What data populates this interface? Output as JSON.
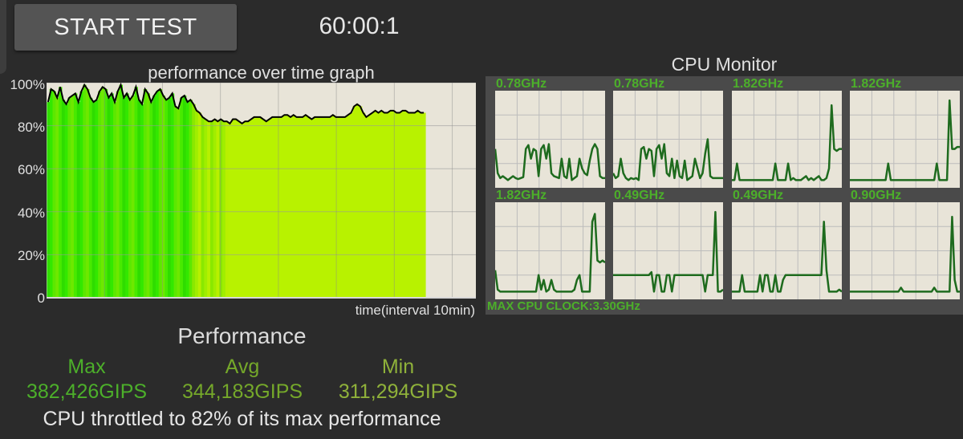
{
  "controls": {
    "start_label": "START TEST",
    "timer": "60:00:1"
  },
  "performance_graph": {
    "title": "performance over time graph",
    "y_ticks": [
      "100%",
      "80%",
      "60%",
      "40%",
      "20%",
      "0"
    ],
    "x_axis_label": "time(interval 10min)"
  },
  "chart_data": {
    "type": "area",
    "title": "performance over time graph",
    "xlabel": "time(interval 10min)",
    "ylabel": "",
    "ylim": [
      0,
      100
    ],
    "y_ticks": [
      "100%",
      "80%",
      "60%",
      "40%",
      "20%",
      "0"
    ],
    "grid": true,
    "series": [
      {
        "values": [
          91,
          97,
          96,
          93,
          98,
          92,
          90,
          93,
          94,
          95,
          91,
          96,
          99,
          97,
          93,
          91,
          92,
          96,
          98,
          97,
          93,
          95,
          91,
          96,
          99,
          93,
          95,
          92,
          94,
          98,
          92,
          90,
          97,
          95,
          91,
          94,
          96,
          97,
          94,
          92,
          93,
          95,
          89,
          88,
          93,
          94,
          91,
          92,
          90,
          87,
          86,
          84,
          83,
          82,
          82,
          83,
          82,
          83,
          82,
          82,
          81,
          83,
          83,
          82,
          81,
          82,
          82,
          83,
          84,
          84,
          84,
          83,
          82,
          83,
          84,
          84,
          84,
          84,
          85,
          85,
          84,
          85,
          84,
          84,
          84,
          85,
          84,
          83,
          84,
          84,
          84,
          84,
          84,
          84,
          85,
          84,
          84,
          84,
          84,
          85,
          86,
          89,
          90,
          89,
          86,
          84,
          85,
          86,
          87,
          86,
          87,
          86,
          86,
          87,
          87,
          86,
          86,
          87,
          87,
          86,
          86,
          86,
          87,
          86,
          86
        ]
      }
    ]
  },
  "cpu_monitor": {
    "title": "CPU Monitor",
    "cores": [
      {
        "freq": "0.78GHz",
        "values": [
          40,
          15,
          10,
          12,
          10,
          8,
          10,
          12,
          10,
          9,
          10,
          11,
          40,
          44,
          30,
          40,
          38,
          12,
          40,
          44,
          30,
          45,
          15,
          12,
          11,
          10,
          30,
          12,
          10,
          30,
          8,
          10,
          12,
          30,
          20,
          15,
          13,
          28,
          40,
          45,
          40,
          12,
          10,
          10
        ]
      },
      {
        "freq": "0.78GHz",
        "values": [
          15,
          10,
          12,
          30,
          15,
          10,
          8,
          10,
          9,
          10,
          8,
          40,
          42,
          30,
          40,
          38,
          12,
          40,
          44,
          30,
          45,
          15,
          12,
          30,
          10,
          28,
          12,
          10,
          28,
          8,
          10,
          12,
          30,
          20,
          10,
          15,
          35,
          50,
          12,
          10,
          10,
          10,
          10,
          10
        ]
      },
      {
        "freq": "1.82GHz",
        "values": [
          8,
          8,
          25,
          8,
          8,
          8,
          8,
          8,
          8,
          8,
          8,
          8,
          8,
          8,
          8,
          8,
          8,
          25,
          8,
          8,
          8,
          8,
          25,
          8,
          10,
          8,
          8,
          8,
          10,
          12,
          8,
          10,
          8,
          10,
          12,
          8,
          8,
          10,
          20,
          85,
          40,
          38,
          40,
          40
        ]
      },
      {
        "freq": "1.82GHz",
        "values": [
          8,
          8,
          8,
          8,
          8,
          8,
          8,
          8,
          8,
          8,
          8,
          8,
          8,
          8,
          8,
          25,
          8,
          8,
          8,
          8,
          8,
          8,
          8,
          8,
          8,
          8,
          8,
          8,
          8,
          8,
          8,
          8,
          8,
          8,
          25,
          8,
          8,
          8,
          8,
          90,
          40,
          40,
          42,
          42
        ]
      },
      {
        "freq": "1.82GHz",
        "values": [
          30,
          10,
          8,
          8,
          8,
          8,
          8,
          8,
          8,
          8,
          8,
          8,
          8,
          8,
          8,
          8,
          8,
          25,
          10,
          20,
          8,
          10,
          20,
          10,
          8,
          8,
          8,
          8,
          8,
          8,
          8,
          10,
          20,
          25,
          8,
          8,
          8,
          8,
          80,
          88,
          40,
          38,
          40,
          38
        ]
      },
      {
        "freq": "0.49GHz",
        "values": [
          25,
          25,
          25,
          25,
          25,
          25,
          25,
          25,
          25,
          25,
          25,
          25,
          25,
          25,
          25,
          28,
          8,
          25,
          25,
          8,
          8,
          25,
          25,
          8,
          25,
          25,
          25,
          25,
          25,
          25,
          25,
          25,
          25,
          25,
          25,
          25,
          8,
          25,
          25,
          25,
          90,
          8,
          8,
          10
        ]
      },
      {
        "freq": "0.49GHz",
        "values": [
          8,
          8,
          8,
          8,
          25,
          8,
          8,
          8,
          8,
          8,
          8,
          25,
          8,
          25,
          25,
          8,
          8,
          25,
          8,
          8,
          20,
          25,
          25,
          25,
          25,
          25,
          25,
          25,
          25,
          25,
          25,
          25,
          25,
          25,
          25,
          25,
          80,
          30,
          8,
          8,
          8,
          8,
          10,
          8
        ]
      },
      {
        "freq": "0.90GHz",
        "values": [
          8,
          8,
          8,
          8,
          8,
          8,
          8,
          8,
          8,
          8,
          8,
          8,
          8,
          8,
          8,
          8,
          8,
          8,
          8,
          8,
          12,
          8,
          8,
          8,
          8,
          8,
          8,
          8,
          8,
          8,
          8,
          8,
          8,
          12,
          8,
          8,
          8,
          8,
          8,
          8,
          85,
          20,
          8,
          8
        ]
      }
    ],
    "max_clock": "MAX CPU CLOCK:3.30GHz"
  },
  "summary": {
    "heading": "Performance",
    "max_label": "Max",
    "avg_label": "Avg",
    "min_label": "Min",
    "max_value": "382,426GIPS",
    "avg_value": "344,183GIPS",
    "min_value": "311,294GIPS",
    "throttle_text": "CPU throttled to 82% of its max performance"
  },
  "colors": {
    "background": "#2b2b2b",
    "button": "#545454",
    "plot_bg": "#e8e4d8",
    "core_line": "#1e6b1e",
    "core_label": "#4caf2a",
    "max_color": "#4caf2a",
    "avg_color": "#75a82a",
    "min_color": "#8fb13a"
  }
}
